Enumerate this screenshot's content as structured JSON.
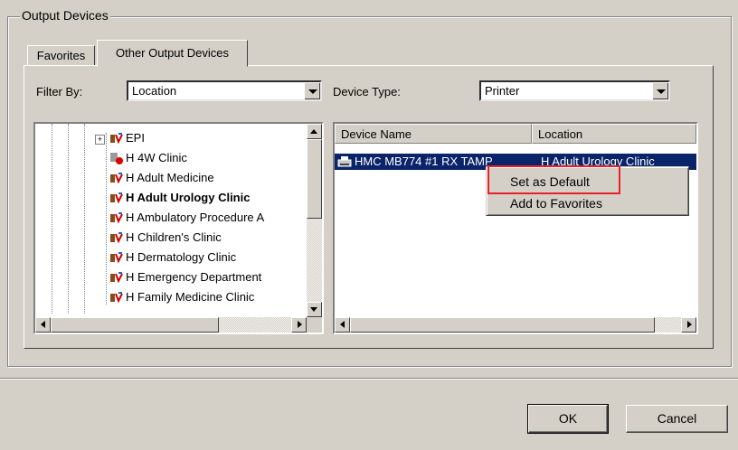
{
  "group": {
    "title": "Output Devices"
  },
  "tabs": [
    {
      "label": "Favorites"
    },
    {
      "label": "Other Output Devices"
    }
  ],
  "filter": {
    "label": "Filter By:",
    "value": "Location"
  },
  "device_type": {
    "label": "Device Type:",
    "value": "Printer"
  },
  "tree": {
    "items": [
      {
        "label": "EPI",
        "bold": false
      },
      {
        "label": "H 4W Clinic",
        "bold": false
      },
      {
        "label": "H Adult Medicine",
        "bold": false
      },
      {
        "label": "H Adult Urology Clinic",
        "bold": true
      },
      {
        "label": "H Ambulatory Procedure A",
        "bold": false
      },
      {
        "label": "H Children's Clinic",
        "bold": false
      },
      {
        "label": "H Dermatology Clinic",
        "bold": false
      },
      {
        "label": "H Emergency Department",
        "bold": false
      },
      {
        "label": "H Family Medicine Clinic",
        "bold": false
      }
    ]
  },
  "list": {
    "columns": [
      "Device Name",
      "Location"
    ],
    "rows": [
      {
        "device": "HMC MB774 #1 RX TAMP",
        "location": "H Adult Urology Clinic"
      }
    ]
  },
  "context_menu": {
    "items": [
      "Set as Default",
      "Add to Favorites"
    ]
  },
  "buttons": {
    "ok": "OK",
    "cancel": "Cancel"
  },
  "colors": {
    "selection": "#0a246a",
    "highlight_box": "#e8202a",
    "dialog_bg": "#d4d0c8"
  }
}
